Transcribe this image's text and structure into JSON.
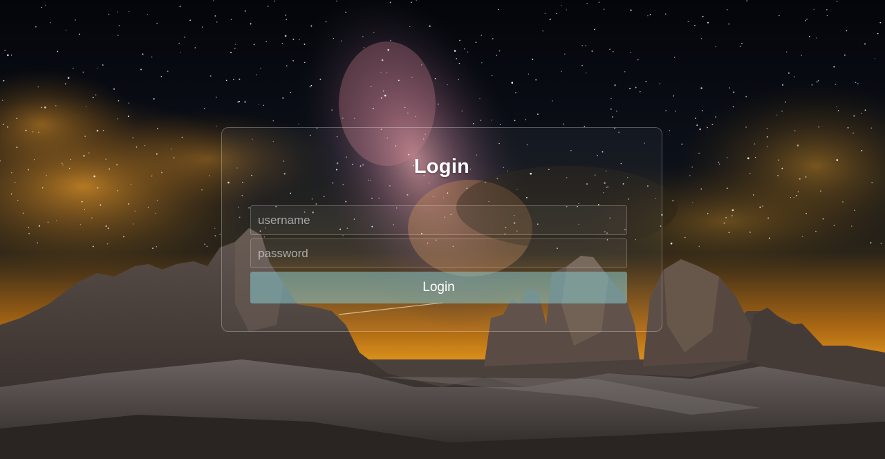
{
  "login": {
    "title": "Login",
    "username_placeholder": "username",
    "password_placeholder": "password",
    "button_label": "Login"
  },
  "background": {
    "subject": "night-sky-milky-way-over-mountains",
    "colors": {
      "sky_top": "#04060b",
      "sky_mid": "#151a24",
      "glow": "#f0a520",
      "mountain": "#3e3a38",
      "card_border": "#ffffff",
      "button": "#87c8cd"
    }
  }
}
